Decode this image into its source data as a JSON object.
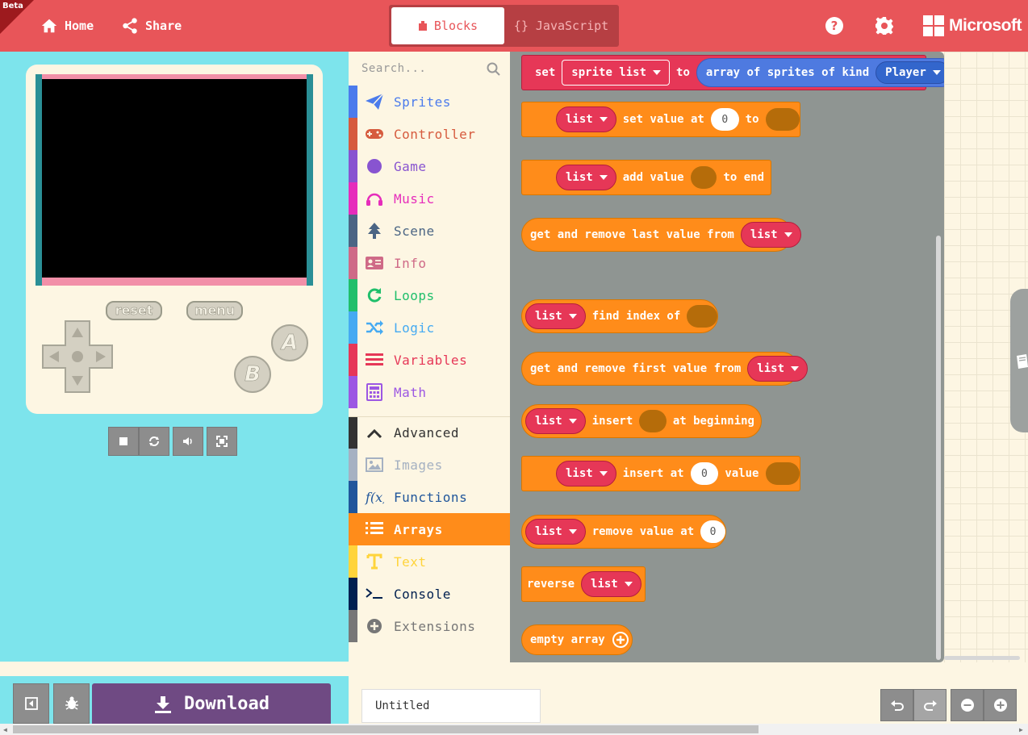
{
  "header": {
    "beta_label": "Beta",
    "home_label": "Home",
    "share_label": "Share",
    "editor_tabs": [
      {
        "label": "Blocks",
        "active": true
      },
      {
        "label": "{} JavaScript",
        "active": false
      }
    ],
    "brand": "Microsoft",
    "accent_color": "#e85559"
  },
  "simulator": {
    "reset_label": "reset",
    "menu_label": "menu",
    "a_label": "A",
    "b_label": "B",
    "controls": [
      "stop-icon",
      "restart-icon",
      "sound-icon",
      "fullscreen-icon"
    ]
  },
  "toolbox": {
    "search_placeholder": "Search...",
    "categories": [
      {
        "label": "Sprites",
        "color": "#4b7bec",
        "icon": "paper-plane-icon"
      },
      {
        "label": "Controller",
        "color": "#d65b3e",
        "icon": "gamepad-icon"
      },
      {
        "label": "Game",
        "color": "#8854d0",
        "icon": "circle-icon"
      },
      {
        "label": "Music",
        "color": "#e62dbb",
        "icon": "headphones-icon"
      },
      {
        "label": "Scene",
        "color": "#4b6584",
        "icon": "tree-icon"
      },
      {
        "label": "Info",
        "color": "#cf6a87",
        "icon": "id-card-icon"
      },
      {
        "label": "Loops",
        "color": "#20bf6b",
        "icon": "loop-icon"
      },
      {
        "label": "Logic",
        "color": "#45aaf2",
        "icon": "shuffle-icon"
      },
      {
        "label": "Variables",
        "color": "#e63757",
        "icon": "list-lines-icon"
      },
      {
        "label": "Math",
        "color": "#9c57e3",
        "icon": "calculator-icon"
      },
      {
        "label": "Advanced",
        "color": "#333333",
        "icon": "chevron-up-icon"
      },
      {
        "label": "Images",
        "color": "#a5b1c2",
        "icon": "image-icon"
      },
      {
        "label": "Functions",
        "color": "#20569b",
        "icon": "function-icon"
      },
      {
        "label": "Arrays",
        "color": "#ff8c1a",
        "icon": "array-list-icon",
        "selected": true
      },
      {
        "label": "Text",
        "color": "#ffd43b",
        "icon": "text-icon"
      },
      {
        "label": "Console",
        "color": "#002050",
        "icon": "terminal-icon"
      },
      {
        "label": "Extensions",
        "color": "#777777",
        "icon": "plus-circle-icon"
      }
    ]
  },
  "flyout": {
    "set_block": {
      "set": "set",
      "variable": "sprite list",
      "to": "to",
      "func": "array of sprites of kind",
      "kind": "Player"
    },
    "set_value_block": {
      "var": "list",
      "text1": "set value at",
      "index": "0",
      "text2": "to"
    },
    "add_value_block": {
      "var": "list",
      "text1": "add value",
      "text2": "to end"
    },
    "remove_last_block": {
      "text": "get and remove last value from",
      "var": "list"
    },
    "find_index_block": {
      "var": "list",
      "text": "find index of"
    },
    "remove_first_block": {
      "text": "get and remove first value from",
      "var": "list"
    },
    "insert_beginning_block": {
      "var": "list",
      "text1": "insert",
      "text2": "at beginning"
    },
    "insert_at_block": {
      "var": "list",
      "text1": "insert at",
      "index": "0",
      "text2": "value"
    },
    "remove_at_block": {
      "var": "list",
      "text": "remove value at",
      "index": "0"
    },
    "reverse_block": {
      "text": "reverse",
      "var": "list"
    },
    "empty_array_block": {
      "text": "empty array"
    }
  },
  "footer": {
    "download_label": "Download",
    "project_name": "Untitled"
  }
}
